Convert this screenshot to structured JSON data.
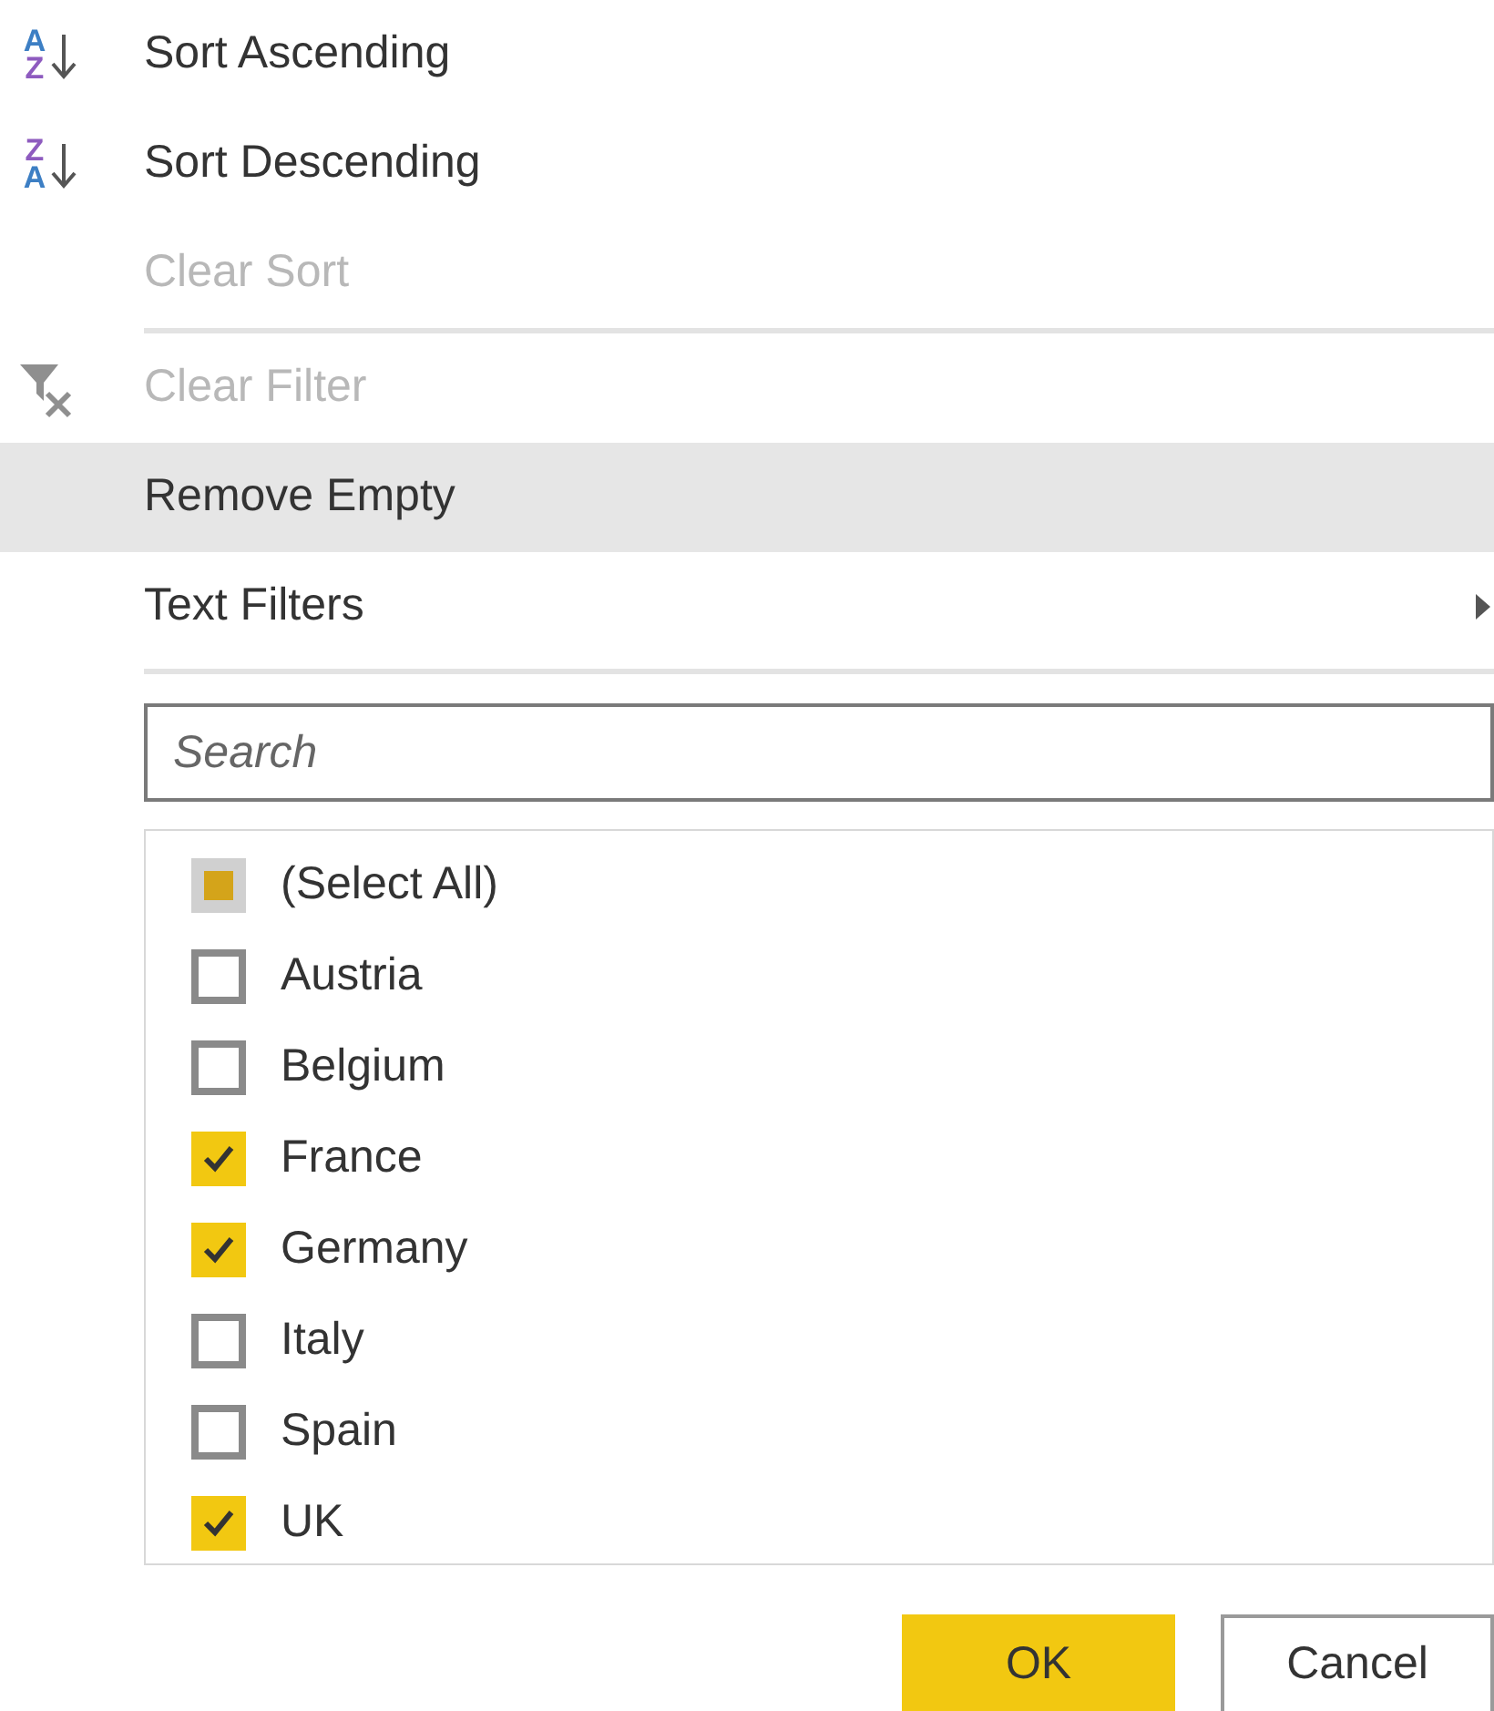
{
  "menu_sections": [
    [
      {
        "label": "Sort Ascending",
        "icon": {
          "kind": "sort",
          "top": "A",
          "bottom": "Z"
        },
        "disabled": false,
        "selected": false,
        "submenu": false
      },
      {
        "label": "Sort Descending",
        "icon": {
          "kind": "sort",
          "top": "Z",
          "bottom": "A"
        },
        "disabled": false,
        "selected": false,
        "submenu": false
      },
      {
        "label": "Clear Sort",
        "icon": {
          "kind": "none"
        },
        "disabled": true,
        "selected": false,
        "submenu": false
      }
    ],
    [
      {
        "label": "Clear Filter",
        "icon": {
          "kind": "clear_filter"
        },
        "disabled": true,
        "selected": false,
        "submenu": false
      },
      {
        "label": "Remove Empty",
        "icon": {
          "kind": "none"
        },
        "disabled": false,
        "selected": true,
        "submenu": false
      },
      {
        "label": "Text Filters",
        "icon": {
          "kind": "none"
        },
        "disabled": false,
        "selected": false,
        "submenu": true
      }
    ]
  ],
  "search": {
    "placeholder": "Search"
  },
  "values": [
    {
      "label": "(Select All)",
      "checked": false,
      "mixed": true
    },
    {
      "label": "Austria",
      "checked": false,
      "mixed": false
    },
    {
      "label": "Belgium",
      "checked": false,
      "mixed": false
    },
    {
      "label": "France",
      "checked": true,
      "mixed": false
    },
    {
      "label": "Germany",
      "checked": true,
      "mixed": false
    },
    {
      "label": "Italy",
      "checked": false,
      "mixed": false
    },
    {
      "label": "Spain",
      "checked": false,
      "mixed": false
    },
    {
      "label": "UK",
      "checked": true,
      "mixed": false
    }
  ],
  "buttons": [
    {
      "label": "OK",
      "kind": "primary"
    },
    {
      "label": "Cancel",
      "kind": "secondary"
    }
  ]
}
